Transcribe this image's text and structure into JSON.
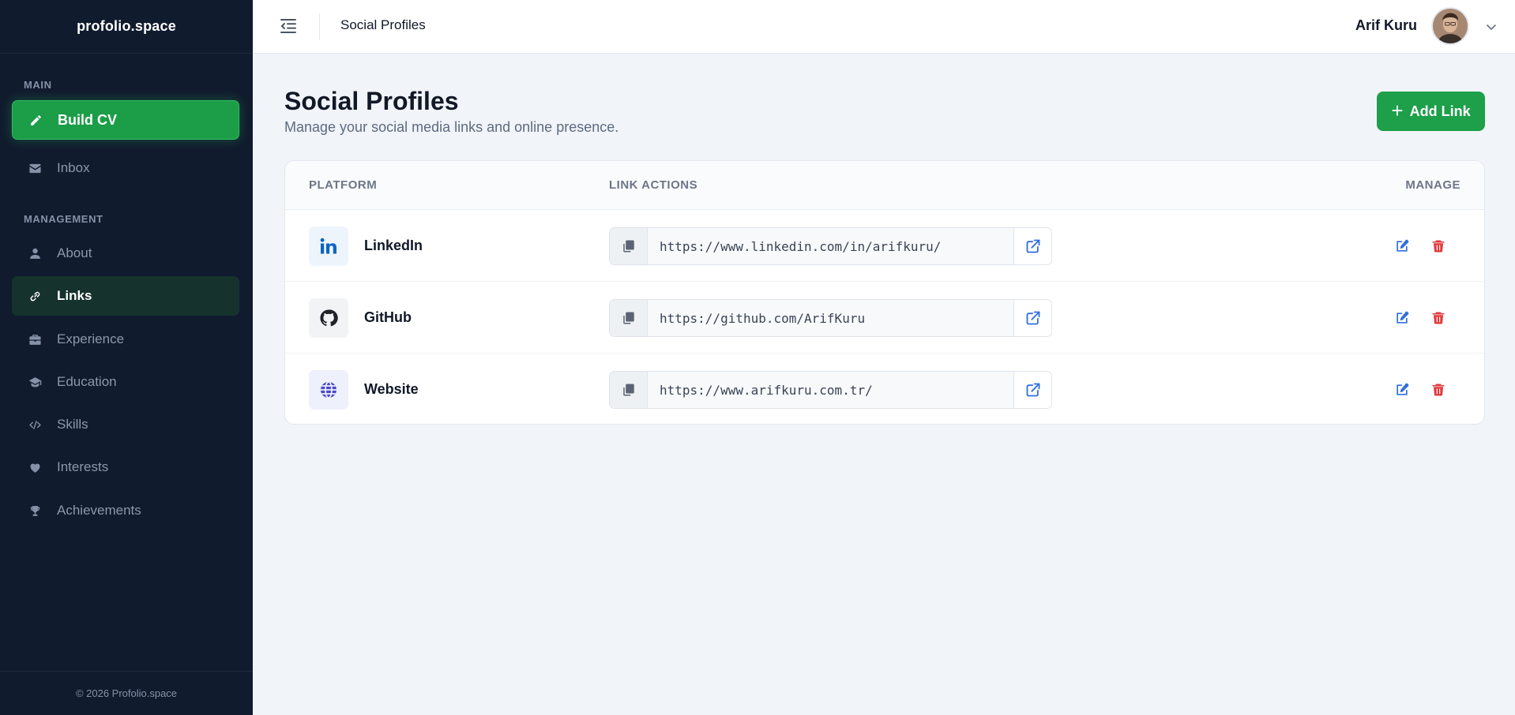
{
  "brand": "profolio.space",
  "sidebar": {
    "sections": [
      {
        "label": "MAIN"
      },
      {
        "label": "MANAGEMENT"
      }
    ],
    "items": [
      {
        "label": "Build CV",
        "icon": "pencil-icon",
        "state": "primary"
      },
      {
        "label": "Inbox",
        "icon": "envelope-icon"
      },
      {
        "label": "About",
        "icon": "user-icon"
      },
      {
        "label": "Links",
        "icon": "link-icon",
        "state": "active"
      },
      {
        "label": "Experience",
        "icon": "briefcase-icon"
      },
      {
        "label": "Education",
        "icon": "graduation-cap-icon"
      },
      {
        "label": "Skills",
        "icon": "code-icon"
      },
      {
        "label": "Interests",
        "icon": "heart-icon"
      },
      {
        "label": "Achievements",
        "icon": "trophy-icon"
      }
    ],
    "footer": "© 2026 Profolio.space"
  },
  "header": {
    "title": "Social Profiles",
    "user_name": "Arif Kuru"
  },
  "main": {
    "title": "Social Profiles",
    "subtitle": "Manage your social media links and online presence.",
    "add_button": "Add Link",
    "table": {
      "columns": [
        "PLATFORM",
        "LINK ACTIONS",
        "MANAGE"
      ],
      "rows": [
        {
          "platform": "LinkedIn",
          "icon": "linkedin-icon",
          "url": "https://www.linkedin.com/in/arifkuru/"
        },
        {
          "platform": "GitHub",
          "icon": "github-icon",
          "url": "https://github.com/ArifKuru"
        },
        {
          "platform": "Website",
          "icon": "globe-icon",
          "url": "https://www.arifkuru.com.tr/"
        }
      ]
    }
  },
  "colors": {
    "sidebar_bg": "#111b2e",
    "accent_green": "#1e9f4a",
    "active_bg": "#15332c",
    "link_blue": "#2f6fe0",
    "danger_red": "#e0393e"
  }
}
